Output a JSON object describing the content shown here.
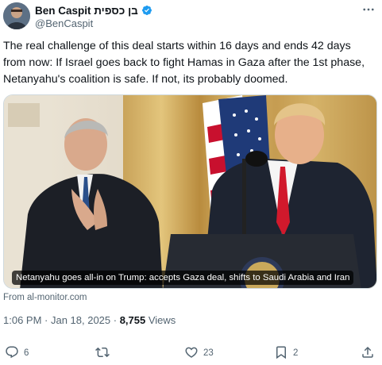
{
  "author": {
    "name": "Ben Caspit בן כספית",
    "handle": "@BenCaspit",
    "verified": true
  },
  "tweet": {
    "text": "The real challenge of this deal starts within 16 days and ends 42 days from now: If Israel goes back to fight Hamas in Gaza after the 1st phase, Netanyahu's coalition is safe. If not, its probably doomed."
  },
  "card": {
    "caption": "Netanyahu goes all-in on Trump: accepts Gaza deal, shifts to Saudi Arabia and Iran",
    "source": "From al-monitor.com"
  },
  "meta": {
    "timestamp": "1:06 PM · Jan 18, 2025 · ",
    "views_count": "8,755",
    "views_label": " Views"
  },
  "actions": {
    "replies": "6",
    "reposts": "",
    "likes": "23",
    "bookmarks": "2"
  },
  "colors": {
    "verified": "#1d9bf0",
    "muted": "#536471",
    "text": "#0f1419"
  },
  "icons": [
    "more-icon",
    "verified-badge-icon",
    "reply-icon",
    "repost-icon",
    "like-icon",
    "bookmark-icon",
    "share-icon"
  ]
}
